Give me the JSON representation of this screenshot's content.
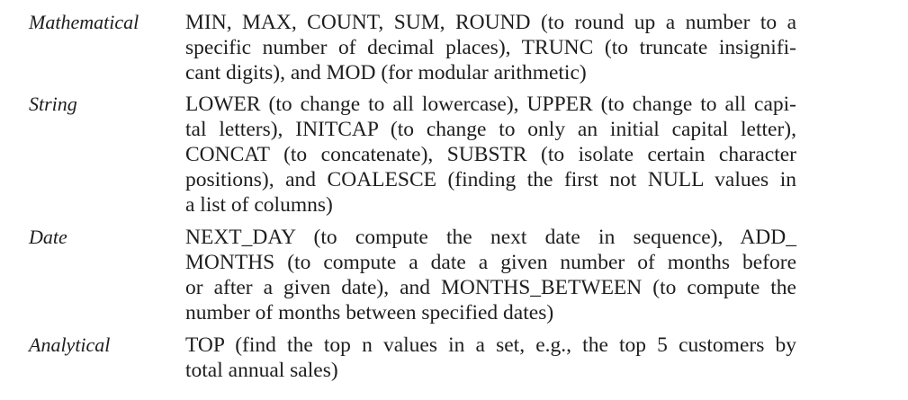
{
  "rows": [
    {
      "category": "Mathematical",
      "lines": [
        "MIN, MAX, COUNT, SUM, ROUND (to round up a number to a",
        "specific number of decimal places), TRUNC (to truncate insignifi-",
        "cant digits), and MOD (for modular arithmetic)"
      ]
    },
    {
      "category": "String",
      "lines": [
        "LOWER (to change to all lowercase), UPPER (to change to all capi-",
        "tal letters), INITCAP (to change to only an initial capital letter),",
        "CONCAT (to concatenate), SUBSTR (to isolate certain character",
        "positions), and COALESCE (finding the first not NULL values in",
        "a list of columns)"
      ]
    },
    {
      "category": "Date",
      "lines": [
        "NEXT_DAY (to compute the next date in sequence), ADD_",
        "MONTHS (to compute a date a given number of months before",
        "or after a given date), and MONTHS_BETWEEN (to compute the",
        "number of months between specified dates)"
      ]
    },
    {
      "category": "Analytical",
      "lines": [
        "TOP (find the top n values in a set, e.g., the top 5 customers by",
        "total annual sales)"
      ]
    }
  ]
}
